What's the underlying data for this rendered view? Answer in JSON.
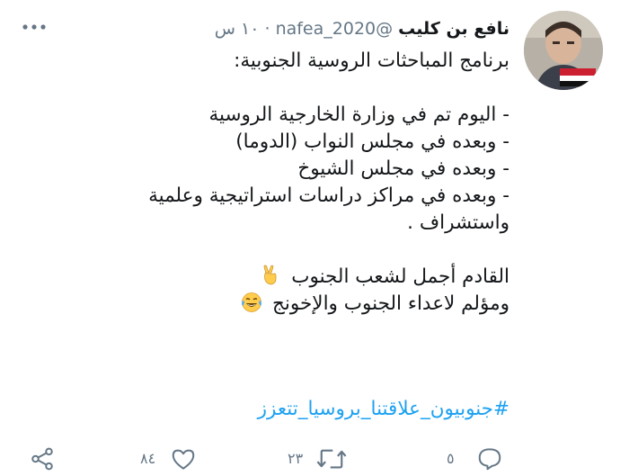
{
  "tweet": {
    "display_name": "نافع بن كليب",
    "handle": "@nafea_2020",
    "separator": "·",
    "time": "١٠ س",
    "more_icon": "more-dots-icon",
    "lines": [
      "برنامج المباحثات الروسية الجنوبية:",
      "",
      "- اليوم تم في وزارة الخارجية الروسية",
      "- وبعده في مجلس النواب (الدوما)",
      "- وبعده في مجلس الشيوخ",
      "- وبعده في مراكز دراسات استراتيجية وعلمية",
      "واستشراف .",
      "",
      "القادم أجمل لشعب الجنوب",
      "ومؤلم لاعداء الجنوب والإخونج"
    ],
    "emoji_victory": "victory-hand-emoji",
    "emoji_laugh": "tears-of-joy-emoji",
    "hashtag": "#جنوبيون_علاقتنا_بروسيا_تتعزز"
  },
  "actions": {
    "reply_count": "٥",
    "retweet_count": "٢٣",
    "like_count": "٨٤",
    "reply_icon": "reply-icon",
    "retweet_icon": "retweet-icon",
    "like_icon": "heart-icon",
    "share_icon": "share-icon"
  },
  "colors": {
    "text": "#14171a",
    "secondary": "#657786",
    "link": "#1da1f2"
  }
}
